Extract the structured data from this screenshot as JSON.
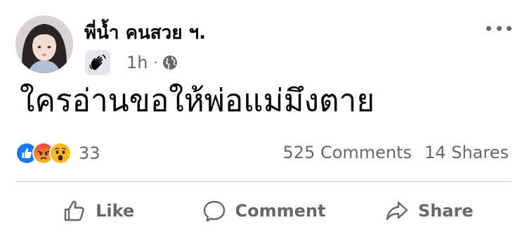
{
  "post": {
    "author_name": "พี่น้ำ คนสวย ฯ.",
    "badge_icon": "waving-hand-icon",
    "timestamp": "1h",
    "separator": "·",
    "privacy_icon": "globe-icon",
    "text": "ใครอ่านขอให้พ่อแม่มึงตาย"
  },
  "reactions": {
    "types": [
      "like",
      "angry",
      "wow"
    ],
    "count": "33"
  },
  "stats": {
    "comments": "525 Comments",
    "shares": "14 Shares"
  },
  "actions": {
    "like": "Like",
    "comment": "Comment",
    "share": "Share"
  },
  "colors": {
    "text_primary": "#050505",
    "text_secondary": "#65676b",
    "like_blue": "#1877f2",
    "angry_orange": "#f2603a",
    "wow_yellow": "#f7b928",
    "divider": "#ced0d4"
  }
}
